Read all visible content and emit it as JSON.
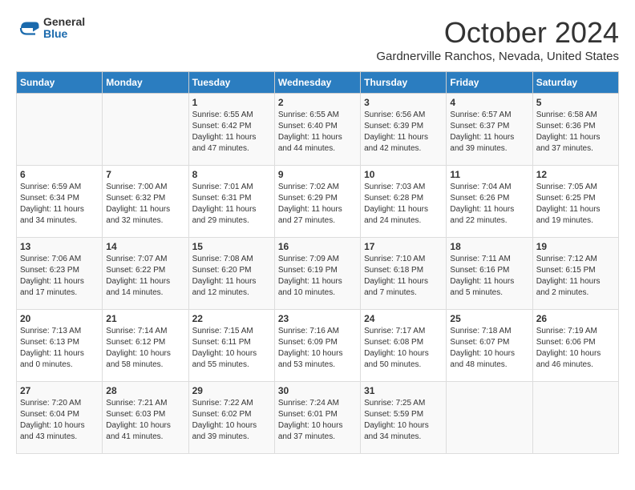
{
  "header": {
    "logo_general": "General",
    "logo_blue": "Blue",
    "month_title": "October 2024",
    "subtitle": "Gardnerville Ranchos, Nevada, United States"
  },
  "weekdays": [
    "Sunday",
    "Monday",
    "Tuesday",
    "Wednesday",
    "Thursday",
    "Friday",
    "Saturday"
  ],
  "weeks": [
    [
      {
        "day": "",
        "info": ""
      },
      {
        "day": "",
        "info": ""
      },
      {
        "day": "1",
        "info": "Sunrise: 6:55 AM\nSunset: 6:42 PM\nDaylight: 11 hours and 47 minutes."
      },
      {
        "day": "2",
        "info": "Sunrise: 6:55 AM\nSunset: 6:40 PM\nDaylight: 11 hours and 44 minutes."
      },
      {
        "day": "3",
        "info": "Sunrise: 6:56 AM\nSunset: 6:39 PM\nDaylight: 11 hours and 42 minutes."
      },
      {
        "day": "4",
        "info": "Sunrise: 6:57 AM\nSunset: 6:37 PM\nDaylight: 11 hours and 39 minutes."
      },
      {
        "day": "5",
        "info": "Sunrise: 6:58 AM\nSunset: 6:36 PM\nDaylight: 11 hours and 37 minutes."
      }
    ],
    [
      {
        "day": "6",
        "info": "Sunrise: 6:59 AM\nSunset: 6:34 PM\nDaylight: 11 hours and 34 minutes."
      },
      {
        "day": "7",
        "info": "Sunrise: 7:00 AM\nSunset: 6:32 PM\nDaylight: 11 hours and 32 minutes."
      },
      {
        "day": "8",
        "info": "Sunrise: 7:01 AM\nSunset: 6:31 PM\nDaylight: 11 hours and 29 minutes."
      },
      {
        "day": "9",
        "info": "Sunrise: 7:02 AM\nSunset: 6:29 PM\nDaylight: 11 hours and 27 minutes."
      },
      {
        "day": "10",
        "info": "Sunrise: 7:03 AM\nSunset: 6:28 PM\nDaylight: 11 hours and 24 minutes."
      },
      {
        "day": "11",
        "info": "Sunrise: 7:04 AM\nSunset: 6:26 PM\nDaylight: 11 hours and 22 minutes."
      },
      {
        "day": "12",
        "info": "Sunrise: 7:05 AM\nSunset: 6:25 PM\nDaylight: 11 hours and 19 minutes."
      }
    ],
    [
      {
        "day": "13",
        "info": "Sunrise: 7:06 AM\nSunset: 6:23 PM\nDaylight: 11 hours and 17 minutes."
      },
      {
        "day": "14",
        "info": "Sunrise: 7:07 AM\nSunset: 6:22 PM\nDaylight: 11 hours and 14 minutes."
      },
      {
        "day": "15",
        "info": "Sunrise: 7:08 AM\nSunset: 6:20 PM\nDaylight: 11 hours and 12 minutes."
      },
      {
        "day": "16",
        "info": "Sunrise: 7:09 AM\nSunset: 6:19 PM\nDaylight: 11 hours and 10 minutes."
      },
      {
        "day": "17",
        "info": "Sunrise: 7:10 AM\nSunset: 6:18 PM\nDaylight: 11 hours and 7 minutes."
      },
      {
        "day": "18",
        "info": "Sunrise: 7:11 AM\nSunset: 6:16 PM\nDaylight: 11 hours and 5 minutes."
      },
      {
        "day": "19",
        "info": "Sunrise: 7:12 AM\nSunset: 6:15 PM\nDaylight: 11 hours and 2 minutes."
      }
    ],
    [
      {
        "day": "20",
        "info": "Sunrise: 7:13 AM\nSunset: 6:13 PM\nDaylight: 11 hours and 0 minutes."
      },
      {
        "day": "21",
        "info": "Sunrise: 7:14 AM\nSunset: 6:12 PM\nDaylight: 10 hours and 58 minutes."
      },
      {
        "day": "22",
        "info": "Sunrise: 7:15 AM\nSunset: 6:11 PM\nDaylight: 10 hours and 55 minutes."
      },
      {
        "day": "23",
        "info": "Sunrise: 7:16 AM\nSunset: 6:09 PM\nDaylight: 10 hours and 53 minutes."
      },
      {
        "day": "24",
        "info": "Sunrise: 7:17 AM\nSunset: 6:08 PM\nDaylight: 10 hours and 50 minutes."
      },
      {
        "day": "25",
        "info": "Sunrise: 7:18 AM\nSunset: 6:07 PM\nDaylight: 10 hours and 48 minutes."
      },
      {
        "day": "26",
        "info": "Sunrise: 7:19 AM\nSunset: 6:06 PM\nDaylight: 10 hours and 46 minutes."
      }
    ],
    [
      {
        "day": "27",
        "info": "Sunrise: 7:20 AM\nSunset: 6:04 PM\nDaylight: 10 hours and 43 minutes."
      },
      {
        "day": "28",
        "info": "Sunrise: 7:21 AM\nSunset: 6:03 PM\nDaylight: 10 hours and 41 minutes."
      },
      {
        "day": "29",
        "info": "Sunrise: 7:22 AM\nSunset: 6:02 PM\nDaylight: 10 hours and 39 minutes."
      },
      {
        "day": "30",
        "info": "Sunrise: 7:24 AM\nSunset: 6:01 PM\nDaylight: 10 hours and 37 minutes."
      },
      {
        "day": "31",
        "info": "Sunrise: 7:25 AM\nSunset: 5:59 PM\nDaylight: 10 hours and 34 minutes."
      },
      {
        "day": "",
        "info": ""
      },
      {
        "day": "",
        "info": ""
      }
    ]
  ]
}
